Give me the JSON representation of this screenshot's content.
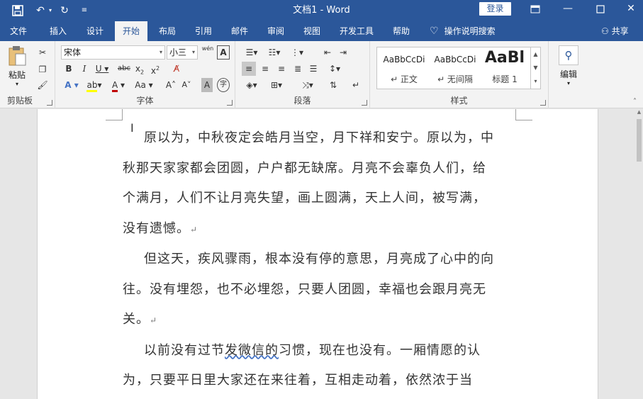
{
  "titlebar": {
    "doc_title": "文档1  -  Word",
    "login": "登录",
    "quick_access": {
      "save": "save-icon",
      "undo": "undo-icon",
      "redo": "redo-icon",
      "customize": "customize-icon"
    }
  },
  "tabs": [
    "文件",
    "插入",
    "设计",
    "开始",
    "布局",
    "引用",
    "邮件",
    "审阅",
    "视图",
    "开发工具",
    "帮助"
  ],
  "active_tab": "开始",
  "tell_me": "操作说明搜索",
  "share": "共享",
  "ribbon": {
    "clipboard": {
      "paste": "粘贴",
      "label": "剪贴板"
    },
    "font": {
      "name": "宋体",
      "size": "小三",
      "label": "字体",
      "wen": "wén",
      "aa": "Aa"
    },
    "paragraph": {
      "label": "段落"
    },
    "styles": {
      "label": "样式",
      "items": [
        {
          "sample": "AaBbCcDi",
          "name": "↵ 正文"
        },
        {
          "sample": "AaBbCcDi",
          "name": "↵ 无间隔"
        },
        {
          "sample": "AaBl",
          "name": "标题 1"
        }
      ]
    },
    "editing": {
      "label": "编辑"
    }
  },
  "document": {
    "para1_a": "原以为，中秋夜定会皓月当空，月下祥和安宁。原以为，中",
    "para1_b": "秋那天家家都会团圆，户户都无缺席。月亮不会辜负人们，给",
    "para1_c": "个满月，人们不让月亮失望，画上圆满，天上人间，被写满，",
    "para1_d": "没有遗憾。",
    "para2_a": "但这天，疾风骤雨，根本没有停的意思，月亮成了心中的向",
    "para2_b": "往。没有埋怨，也不必埋怨，只要人团圆，幸福也会跟月亮无",
    "para2_c": "关。",
    "para3_pre": "以前没有过节",
    "para3_wavy": "发微信的",
    "para3_post": "习惯，现在也没有。一厢情愿的认",
    "para3_b": "为，只要平日里大家还在来往着，互相走动着，依然浓于当",
    "para_mark": "↵"
  },
  "colors": {
    "brand": "#2b579a",
    "ribbon_bg": "#f3f3f3"
  }
}
